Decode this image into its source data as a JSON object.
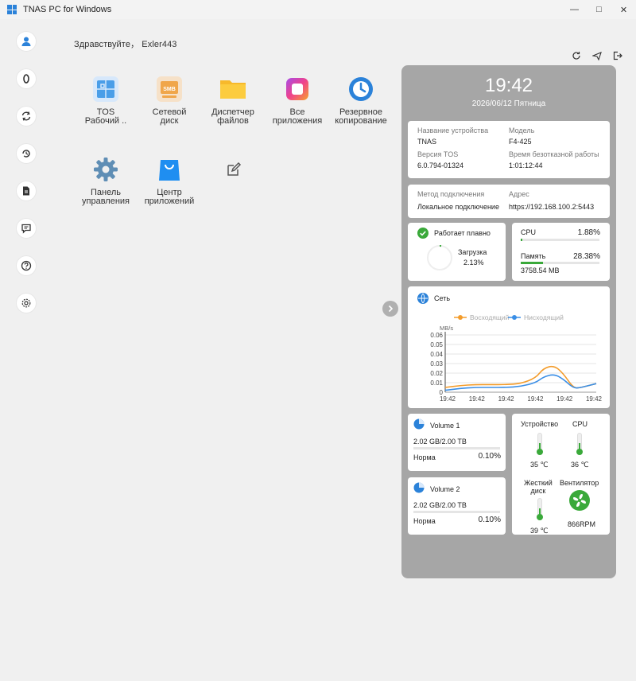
{
  "window": {
    "title": "TNAS PC for Windows",
    "minimize": "—",
    "maximize": "□",
    "close": "✕"
  },
  "greeting": "Здравствуйте， Exler443",
  "apps": [
    {
      "label": "TOS\nРабочий ..",
      "icon": "tos-desktop-icon"
    },
    {
      "label": "Сетевой\nдиск",
      "icon": "smb-network-drive-icon"
    },
    {
      "label": "Диспетчер\nфайлов",
      "icon": "folder-icon"
    },
    {
      "label": "Все\nприложения",
      "icon": "all-apps-icon"
    },
    {
      "label": "Резервное\nкопирование",
      "icon": "backup-clock-icon"
    },
    {
      "label": "Панель\nуправления",
      "icon": "gear-icon"
    },
    {
      "label": "Центр\nприложений",
      "icon": "shopping-bag-icon"
    }
  ],
  "panel": {
    "time": "19:42",
    "date": "2026/06/12 Пятница",
    "device": {
      "name_label": "Название устройства",
      "name": "TNAS",
      "model_label": "Модель",
      "model": "F4-425",
      "tos_label": "Версия TOS",
      "tos": "6.0.794-01324",
      "uptime_label": "Время безотказной работы",
      "uptime": "1:01:12:44"
    },
    "connection": {
      "method_label": "Метод подключения",
      "method": "Локальное подключение",
      "address_label": "Адрес",
      "address": "https://192.168.100.2:5443"
    },
    "status": {
      "text": "Работает плавно",
      "load_label": "Загрузка",
      "load": "2.13%"
    },
    "resources": {
      "cpu_label": "CPU",
      "cpu": "1.88%",
      "cpu_fraction": 0.0188,
      "mem_label": "Память",
      "mem": "28.38%",
      "mem_fraction": 0.2838,
      "mem_used": "3758.54 MB"
    },
    "network": {
      "title": "Сеть",
      "chart_data": {
        "type": "line",
        "ylabel": "MB/s",
        "ylim": [
          0,
          0.06
        ],
        "yticks": [
          "0.06",
          "0.05",
          "0.04",
          "0.03",
          "0.02",
          "0.01",
          "0"
        ],
        "categories": [
          "19:42",
          "19:42",
          "19:42",
          "19:42",
          "19:42",
          "19:42"
        ],
        "x": [
          0,
          0.1,
          0.2,
          0.3,
          0.4,
          0.5,
          0.6,
          0.65,
          0.72,
          0.78,
          0.85,
          0.9,
          1.0
        ],
        "series": [
          {
            "name": "Восходящий",
            "color": "#f39c2b",
            "values": [
              0.005,
              0.007,
              0.008,
              0.008,
              0.008,
              0.009,
              0.015,
              0.025,
              0.028,
              0.02,
              0.004,
              0.005,
              0.009
            ]
          },
          {
            "name": "Нисходящий",
            "color": "#3a8ee6",
            "values": [
              0.002,
              0.004,
              0.005,
              0.005,
              0.005,
              0.006,
              0.01,
              0.016,
              0.019,
              0.014,
              0.004,
              0.005,
              0.009
            ]
          }
        ]
      }
    },
    "volumes": [
      {
        "name": "Volume 1",
        "usage": "2.02 GB/2.00 TB",
        "status": "Норма",
        "percent": "0.10%",
        "fraction": 0.001
      },
      {
        "name": "Volume 2",
        "usage": "2.02 GB/2.00 TB",
        "status": "Норма",
        "percent": "0.10%",
        "fraction": 0.001
      }
    ],
    "sensors": {
      "device_label": "Устройство",
      "device_temp": "35 ℃",
      "cpu_label": "CPU",
      "cpu_temp": "36 ℃",
      "disk_label": "Жесткий\nдиск",
      "disk_temp": "39 ℃",
      "fan_label": "Вентилятор",
      "fan": "866RPM"
    }
  },
  "colors": {
    "accent": "#2b82d9",
    "ok": "#3aa93a",
    "panel": "#a6a6a6"
  }
}
